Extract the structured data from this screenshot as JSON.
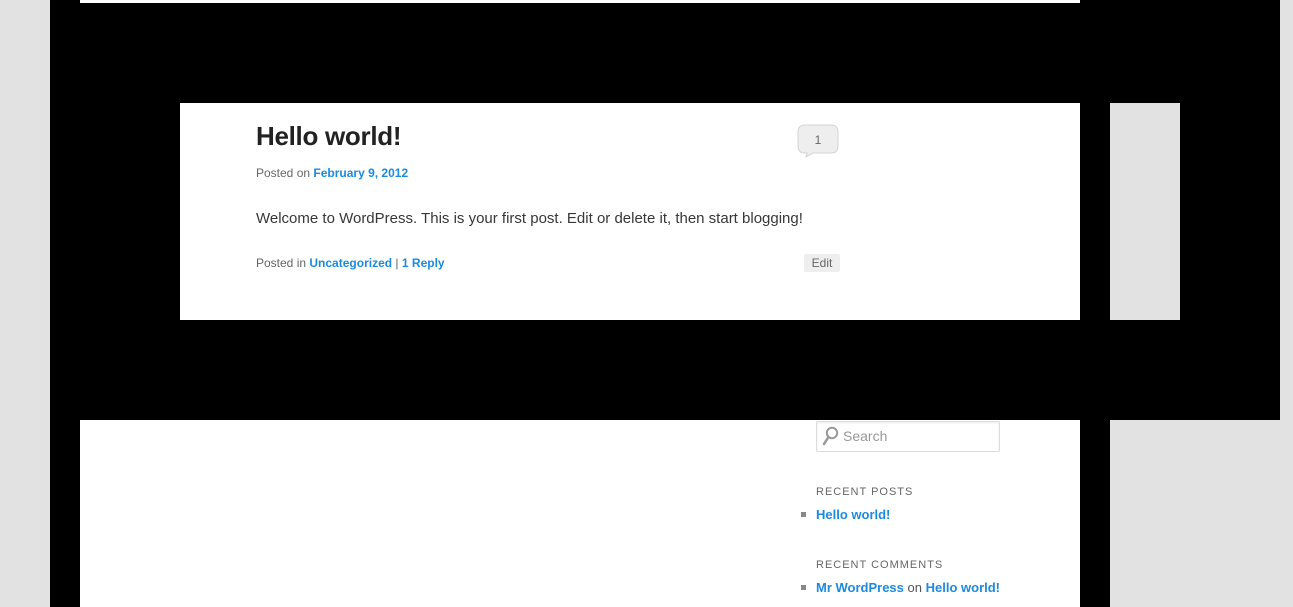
{
  "post": {
    "title": "Hello world!",
    "posted_on_prefix": "Posted on",
    "date": "February 9, 2012",
    "content": "Welcome to WordPress. This is your first post. Edit or delete it, then start blogging!",
    "posted_in_prefix": "Posted in",
    "category": "Uncategorized",
    "separator": "|",
    "reply_link": "1 Reply",
    "comment_count": "1",
    "edit_label": "Edit"
  },
  "sidebar": {
    "search_placeholder": "Search",
    "recent_posts_title": "RECENT POSTS",
    "recent_posts": [
      {
        "label": "Hello world!"
      }
    ],
    "recent_comments_title": "RECENT COMMENTS",
    "recent_comments": [
      {
        "author": "Mr WordPress",
        "on": "on",
        "post": "Hello world!"
      }
    ]
  },
  "colors": {
    "link": "#1b8be0",
    "frame": "#000000",
    "background": "#e2e2e2"
  },
  "icons": {
    "comment": "speech-bubble-icon",
    "search": "magnifier-icon"
  }
}
